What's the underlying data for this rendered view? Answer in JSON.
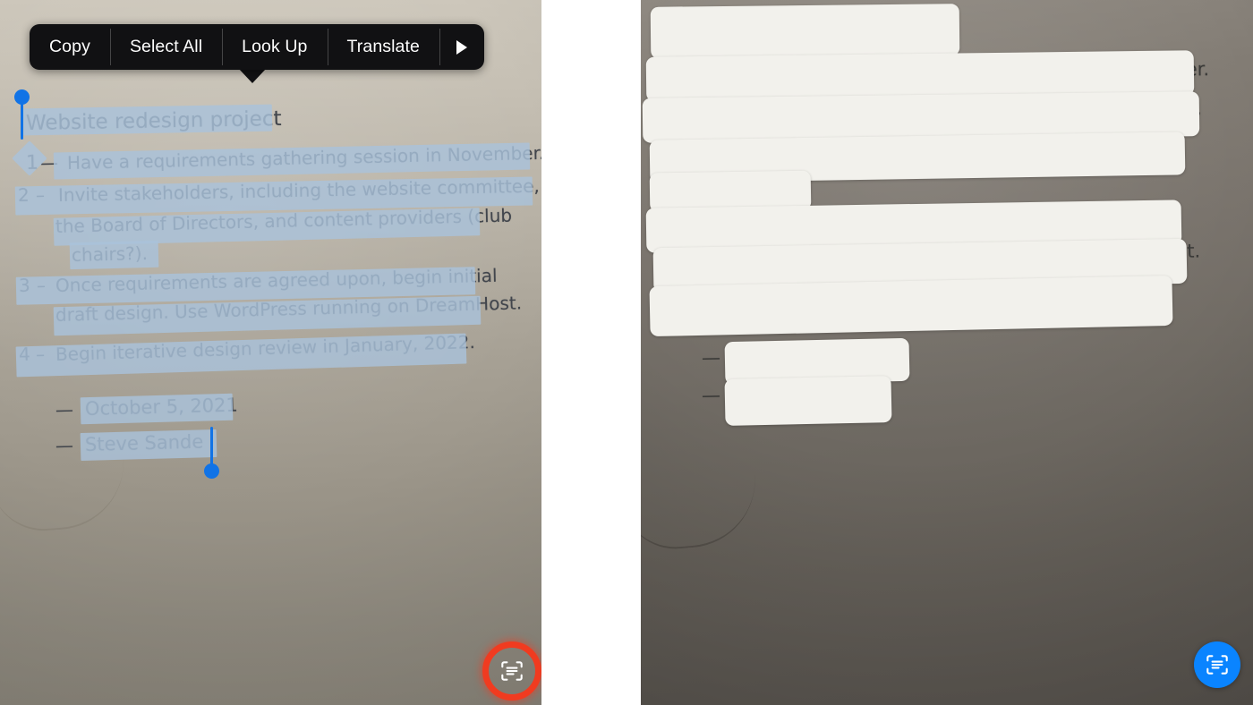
{
  "app": {
    "name": "iOS Live Text",
    "screenshot_width": 1400,
    "screenshot_height": 788
  },
  "colors": {
    "menu_background": "#111113",
    "menu_text": "#fdfdfd",
    "selection_highlight": "#a9c2da",
    "selection_handle": "#1173e6",
    "live_text_button_left": "#f03b20",
    "live_text_button_right": "#0a84ff",
    "live_text_box": "#f2f1ec",
    "ink": "#41454c",
    "left_board": "#b0aa9e",
    "right_board": "#6f6a63"
  },
  "context_menu": {
    "items": [
      {
        "label": "Copy",
        "name": "copy"
      },
      {
        "label": "Select All",
        "name": "select-all"
      },
      {
        "label": "Look Up",
        "name": "look-up"
      },
      {
        "label": "Translate",
        "name": "translate"
      },
      {
        "label": "▶",
        "name": "more"
      }
    ],
    "more_icon": "triangle-right-icon"
  },
  "note": {
    "title": "Website redesign project",
    "lines": [
      {
        "num": "1",
        "dash": "—",
        "text": "Have a requirements gathering session in November."
      },
      {
        "num": "2",
        "dash": "–",
        "text": "Invite stakeholders, including the website committee,"
      },
      {
        "num": "",
        "dash": "",
        "text": "the Board of Directors, and content providers (club"
      },
      {
        "num": "",
        "dash": "",
        "text": "chairs?)."
      },
      {
        "num": "3",
        "dash": "–",
        "text": "Once requirements are agreed upon, begin initial"
      },
      {
        "num": "",
        "dash": "",
        "text": "draft design. Use WordPress running on DreamHost."
      },
      {
        "num": "4",
        "dash": "–",
        "text": "Begin iterative design review in January, 2022."
      }
    ],
    "signature": [
      {
        "dash": "—",
        "text": "October 5, 2021"
      },
      {
        "dash": "—",
        "text": "Steve Sande"
      }
    ]
  },
  "left_panel": {
    "name": "selected-text-photo",
    "selection_active": true,
    "live_text_button": {
      "icon": "live-text-scan-icon",
      "state": "active",
      "color": "#f03b20"
    }
  },
  "right_panel": {
    "name": "detected-text-photo",
    "detection_active": true,
    "live_text_button": {
      "icon": "live-text-scan-icon",
      "state": "enabled",
      "color": "#0a84ff"
    }
  }
}
